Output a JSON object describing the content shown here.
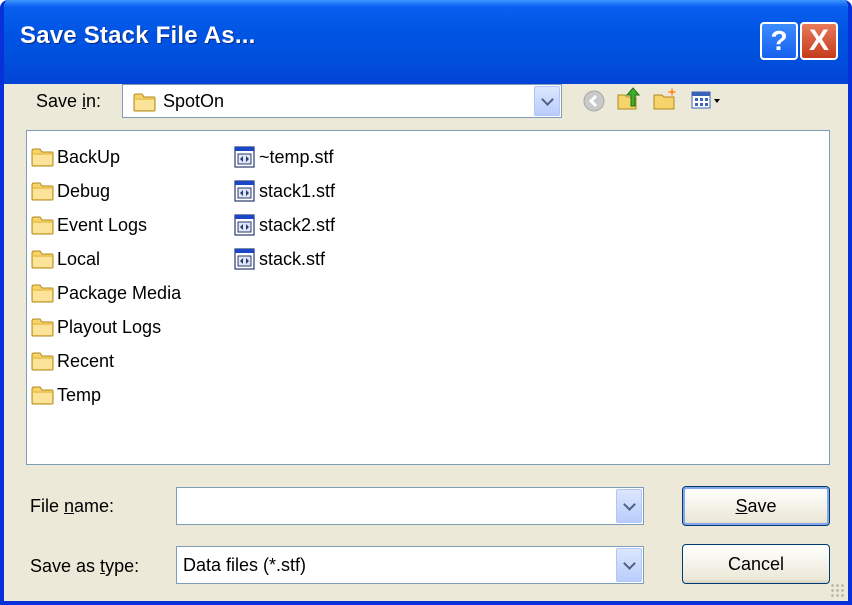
{
  "window": {
    "title": "Save Stack File As..."
  },
  "titlebar_buttons": {
    "help": "?",
    "close": "X"
  },
  "location": {
    "label_pre": "Save ",
    "label_accel": "i",
    "label_post": "n:",
    "value": "SpotOn"
  },
  "toolbar_icons": [
    "back-icon",
    "up-one-level-icon",
    "new-folder-icon",
    "view-menu-icon"
  ],
  "folders": [
    "BackUp",
    "Debug",
    "Event Logs",
    "Local",
    "Package Media",
    "Playout Logs",
    "Recent",
    "Temp"
  ],
  "files": [
    "~temp.stf",
    "stack1.stf",
    "stack2.stf",
    "stack.stf"
  ],
  "filename": {
    "label_pre": "File ",
    "label_accel": "n",
    "label_post": "ame:",
    "value": ""
  },
  "filetype": {
    "label_pre": "Save as ",
    "label_accel": "t",
    "label_post": "ype:",
    "value": "Data files (*.stf)"
  },
  "buttons": {
    "save_accel": "S",
    "save_rest": "ave",
    "cancel": "Cancel"
  },
  "colors": {
    "title_blue": "#0054e3",
    "dialog_bg": "#ece9d8",
    "close_red": "#c63a1a",
    "folder_yellow": "#f6d36b"
  }
}
